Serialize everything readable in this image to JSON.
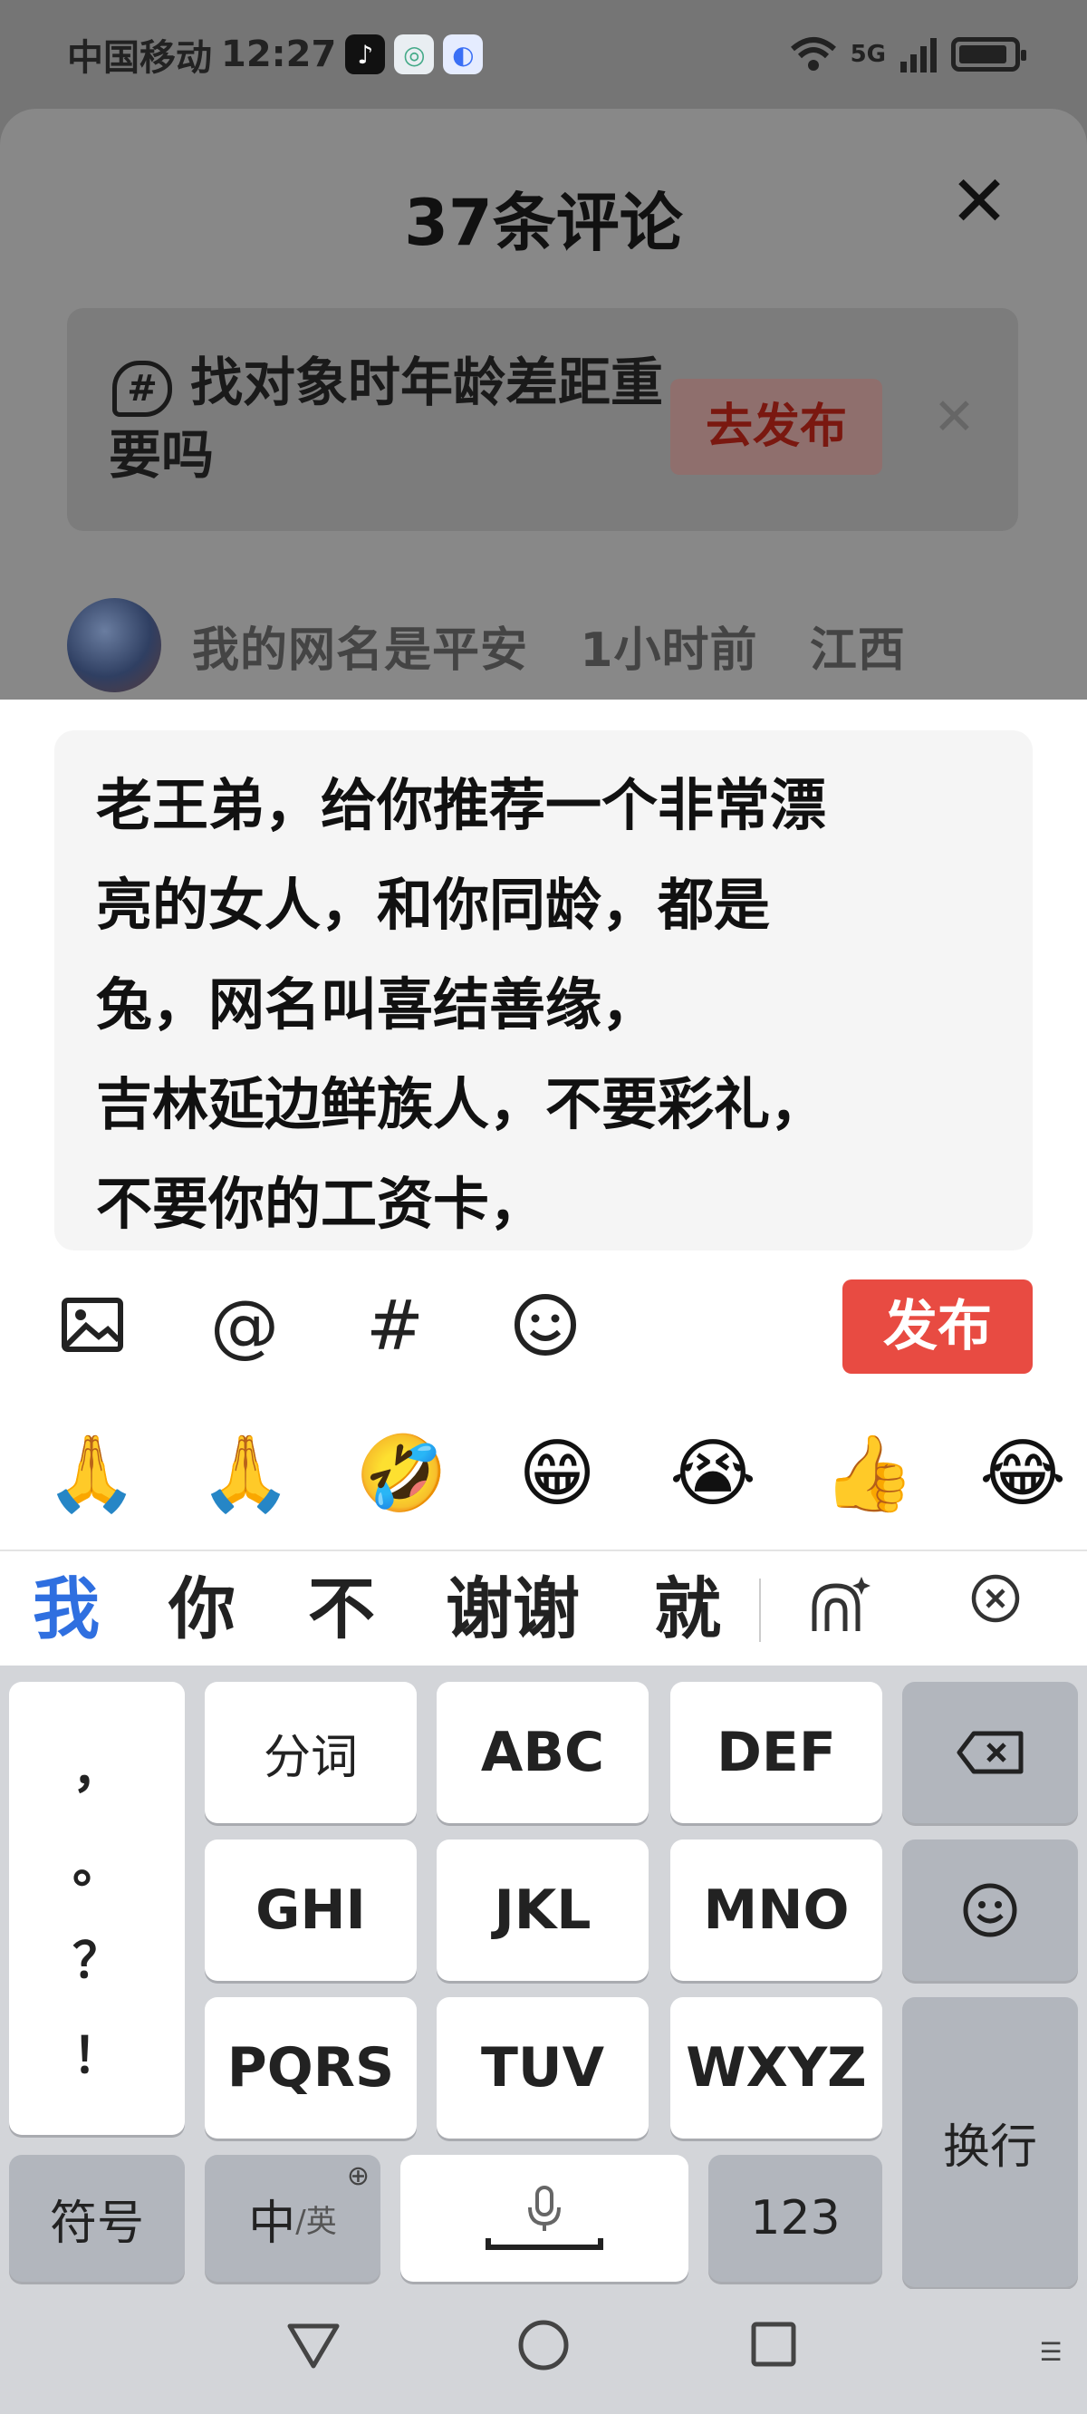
{
  "status_bar": {
    "carrier": "中国移动",
    "time": "12:27",
    "app_icons": [
      "tiktok-icon",
      "app-icon",
      "browser-icon"
    ],
    "signal": "5G",
    "battery_level": 0.9
  },
  "sheet": {
    "title": "37条评论",
    "close_icon": "close-icon"
  },
  "topic": {
    "text": "找对象时年龄差距重要吗",
    "button": "去发布"
  },
  "comment": {
    "author": "我的网名是平安",
    "time_ago": "1小时前",
    "location": "江西"
  },
  "composer": {
    "text": "老王弟，给你推荐一个非常漂\n亮的女人，和你同龄，都是\n兔，网名叫喜结善缘，\n吉林延边鲜族人，不要彩礼，\n不要你的工资卡，",
    "publish_label": "发布",
    "tools": [
      "image-icon",
      "at-icon",
      "hashtag-icon",
      "emoji-icon"
    ],
    "emojis": [
      "🙏",
      "🙏",
      "🤣",
      "😁",
      "😭",
      "👍",
      "😂"
    ]
  },
  "candidates": {
    "items": [
      "我",
      "你",
      "不",
      "谢谢",
      "就"
    ]
  },
  "keyboard": {
    "punct": [
      "，",
      "。",
      "？",
      "！"
    ],
    "row1": [
      "分词",
      "ABC",
      "DEF"
    ],
    "row2": [
      "GHI",
      "JKL",
      "MNO"
    ],
    "row3": [
      "PQRS",
      "TUV",
      "WXYZ"
    ],
    "symbols": "符号",
    "lang_main": "中",
    "lang_sub": "/英",
    "numbers": "123",
    "enter": "换行"
  },
  "accent_color": "#e84b42"
}
